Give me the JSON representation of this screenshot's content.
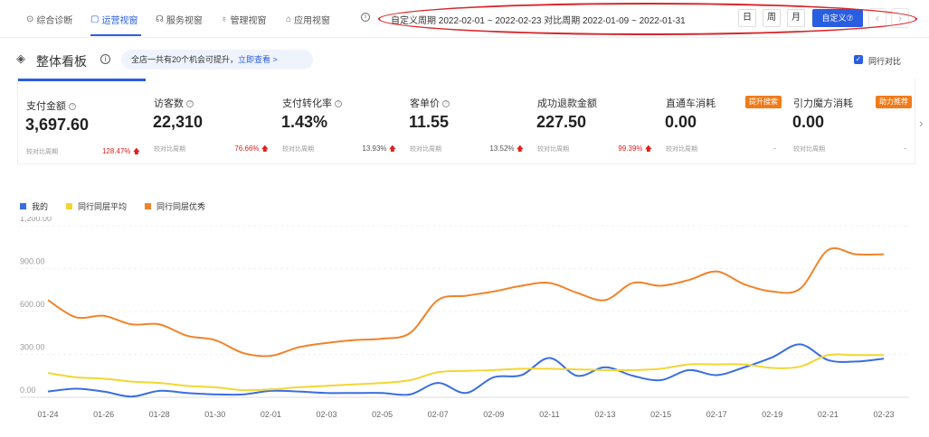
{
  "nav": {
    "tabs": [
      {
        "icon": "location-pin-icon",
        "glyph": "⊙",
        "label": "综合诊断",
        "active": false
      },
      {
        "icon": "shield-icon",
        "glyph": "▢",
        "label": "运营视窗",
        "active": true
      },
      {
        "icon": "headset-icon",
        "glyph": "☊",
        "label": "服务视窗",
        "active": false
      },
      {
        "icon": "badge-icon",
        "glyph": "♁",
        "label": "管理视窗",
        "active": false
      },
      {
        "icon": "home-icon",
        "glyph": "⌂",
        "label": "应用视窗",
        "active": false
      }
    ],
    "info_glyph": "i",
    "period_text": "自定义周期 2022-02-01 ~ 2022-02-23 对比周期 2022-01-09 ~ 2022-01-31",
    "granularity": [
      "日",
      "周",
      "月"
    ],
    "custom_label": "自定义⑦",
    "prev_glyph": "‹",
    "next_glyph": "›",
    "highlight_color": "#d9252a"
  },
  "board": {
    "title": "整体看板",
    "info_glyph": "i",
    "chance_text": "全店一共有20个机会可提升，",
    "chance_link": "立即查看 >",
    "peer_label": "同行对比",
    "peer_checked": true
  },
  "metrics": [
    {
      "label": "支付金额",
      "value": "3,697.60",
      "cmp": "较对比周期",
      "change": "128.47%",
      "trend": "up"
    },
    {
      "label": "访客数",
      "value": "22,310",
      "cmp": "较对比周期",
      "change": "76.66%",
      "trend": "up"
    },
    {
      "label": "支付转化率",
      "value": "1.43%",
      "cmp": "较对比周期",
      "change": "13.93%",
      "trend": "up-gray"
    },
    {
      "label": "客单价",
      "value": "11.55",
      "cmp": "较对比周期",
      "change": "13.52%",
      "trend": "up-gray"
    },
    {
      "label": "成功退款金额",
      "value": "227.50",
      "cmp": "较对比周期",
      "change": "99.39%",
      "trend": "up"
    },
    {
      "label": "直通车消耗",
      "value": "0.00",
      "cmp": "较对比周期",
      "change": "-",
      "badge": "提升搜索"
    },
    {
      "label": "引力魔方消耗",
      "value": "0.00",
      "cmp": "较对比周期",
      "change": "-",
      "badge": "助力推荐"
    }
  ],
  "next_metrics_glyph": "›",
  "chart_data": {
    "type": "line",
    "x": [
      "01-24",
      "01-25",
      "01-26",
      "01-27",
      "01-28",
      "01-29",
      "01-30",
      "01-31",
      "02-01",
      "02-02",
      "02-03",
      "02-04",
      "02-05",
      "02-06",
      "02-07",
      "02-08",
      "02-09",
      "02-10",
      "02-11",
      "02-12",
      "02-13",
      "02-14",
      "02-15",
      "02-16",
      "02-17",
      "02-18",
      "02-19",
      "02-20",
      "02-21",
      "02-22",
      "02-23"
    ],
    "x_tick_labels": [
      "01-24",
      "01-26",
      "01-28",
      "01-30",
      "02-01",
      "02-03",
      "02-05",
      "02-07",
      "02-09",
      "02-11",
      "02-13",
      "02-15",
      "02-17",
      "02-19",
      "02-21",
      "02-23"
    ],
    "y_tick_labels": [
      "0.00",
      "300.00",
      "600.00",
      "900.00",
      "1,200.00"
    ],
    "ylim": [
      0,
      1200
    ],
    "series": [
      {
        "name": "我的",
        "color": "#3a6ee0",
        "values": [
          40,
          60,
          40,
          5,
          45,
          30,
          20,
          20,
          45,
          40,
          30,
          30,
          30,
          20,
          100,
          30,
          140,
          155,
          275,
          150,
          210,
          150,
          120,
          190,
          155,
          210,
          280,
          370,
          260,
          250,
          270
        ]
      },
      {
        "name": "同行同层平均",
        "color": "#f2d634",
        "values": [
          170,
          140,
          130,
          110,
          100,
          80,
          70,
          50,
          55,
          70,
          80,
          90,
          100,
          120,
          175,
          185,
          190,
          200,
          200,
          195,
          190,
          190,
          200,
          230,
          230,
          230,
          205,
          215,
          295,
          295,
          295
        ]
      },
      {
        "name": "同行同层优秀",
        "color": "#f0832a",
        "values": [
          680,
          560,
          570,
          510,
          510,
          430,
          400,
          310,
          290,
          350,
          380,
          400,
          410,
          450,
          680,
          710,
          740,
          780,
          800,
          730,
          680,
          800,
          780,
          820,
          880,
          790,
          740,
          760,
          1030,
          1000,
          1000
        ]
      }
    ],
    "grid": true
  }
}
